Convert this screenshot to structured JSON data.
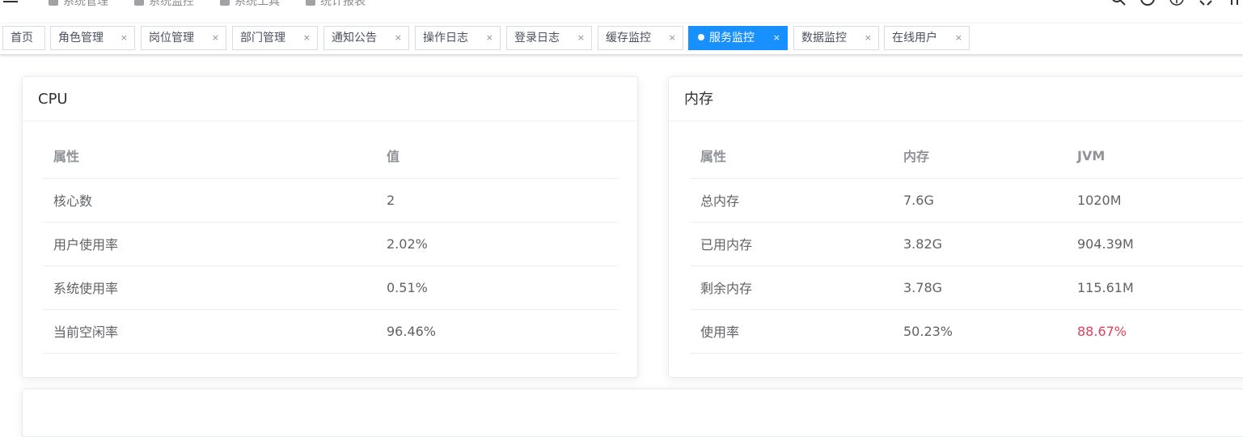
{
  "navbar": {
    "menu": [
      "系统管理",
      "系统监控",
      "系统工具",
      "统计报表"
    ],
    "icons": [
      "search-icon",
      "github-icon",
      "question-icon",
      "fullscreen-icon",
      "font-size-icon"
    ]
  },
  "tags": [
    {
      "label": "首页",
      "closable": false,
      "active": false
    },
    {
      "label": "角色管理",
      "closable": true,
      "active": false
    },
    {
      "label": "岗位管理",
      "closable": true,
      "active": false
    },
    {
      "label": "部门管理",
      "closable": true,
      "active": false
    },
    {
      "label": "通知公告",
      "closable": true,
      "active": false
    },
    {
      "label": "操作日志",
      "closable": true,
      "active": false
    },
    {
      "label": "登录日志",
      "closable": true,
      "active": false
    },
    {
      "label": "缓存监控",
      "closable": true,
      "active": false
    },
    {
      "label": "服务监控",
      "closable": true,
      "active": true
    },
    {
      "label": "数据监控",
      "closable": true,
      "active": false
    },
    {
      "label": "在线用户",
      "closable": true,
      "active": false
    }
  ],
  "tag_close": "×",
  "cpu": {
    "title": "CPU",
    "headers": [
      "属性",
      "值"
    ],
    "rows": [
      [
        "核心数",
        "2"
      ],
      [
        "用户使用率",
        "2.02%"
      ],
      [
        "系统使用率",
        "0.51%"
      ],
      [
        "当前空闲率",
        "96.46%"
      ]
    ]
  },
  "memory": {
    "title": "内存",
    "headers": [
      "属性",
      "内存",
      "JVM"
    ],
    "rows": [
      [
        "总内存",
        "7.6G",
        "1020M"
      ],
      [
        "已用内存",
        "3.82G",
        "904.39M"
      ],
      [
        "剩余内存",
        "3.78G",
        "115.61M"
      ],
      [
        "使用率",
        "50.23%",
        "88.67%"
      ]
    ],
    "warn_color": "#e0405a"
  },
  "colors": {
    "accent": "#1890ff",
    "header_text": "#909399",
    "cell_text": "#606266"
  }
}
